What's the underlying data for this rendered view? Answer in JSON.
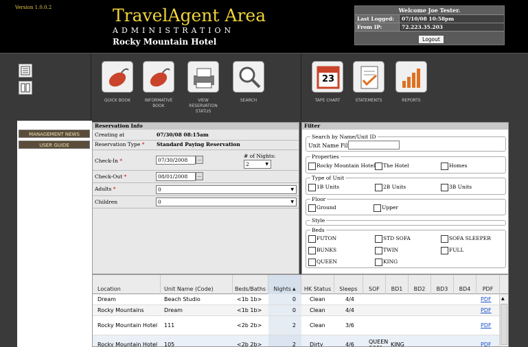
{
  "header": {
    "version": "Version 1.0.0.2",
    "brand": "TravelAgent Area",
    "admin": "ADMINISTRATION",
    "hotel": "Rocky Mountain Hotel",
    "welcome": "Welcome Joe Tester.",
    "last_logged_label": "Last Logged:",
    "last_logged_value": "07/10/08 10:58pm",
    "from_ip_label": "From IP:",
    "from_ip_value": "72.223.35.203",
    "logout": "Logout"
  },
  "toolbar": {
    "quick_book": "QUICK BOOK",
    "informative_book": "INFORMATIVE BOOK",
    "view_reservation": "VIEW RESERVATION STATUS",
    "search": "SEARCH",
    "tape_chart": "TAPE CHART",
    "tape_day": "23",
    "statements": "STATEMENTS",
    "reports": "REPORTS"
  },
  "nav": {
    "management_news": "MANAGEMENT NEWS",
    "user_guide": "USER GUIDE"
  },
  "reservation": {
    "title": "Reservation Info",
    "creating_at_label": "Creating at",
    "creating_at_value": "07/30/08 08:15am",
    "type_label": "Reservation Type",
    "type_value": "Standard Paying Reservation",
    "checkin_label": "Check-In",
    "checkin_value": "07/30/2008",
    "checkout_label": "Check-Out",
    "checkout_value": "08/01/2008",
    "nights_label": "# of Nights:",
    "nights_value": "2",
    "adults_label": "Adults",
    "adults_value": "0",
    "children_label": "Children",
    "children_value": "0",
    "req": "*"
  },
  "filter": {
    "title": "Filter",
    "search_group": "Search by Name/Unit ID",
    "unit_name_label": "Unit Name Filter:",
    "properties_group": "Properties",
    "properties": [
      "Rocky Mountain Hotel",
      "The Hotel",
      "Homes"
    ],
    "type_group": "Type of Unit",
    "types": [
      "1B Units",
      "2B Units",
      "3B Units"
    ],
    "floor_group": "Floor",
    "floors": [
      "Ground",
      "Upper"
    ],
    "style_group": "Style",
    "beds_group": "Beds",
    "beds": [
      "FUTON",
      "STD SOFA",
      "SOFA SLEEPER",
      "BUNKS",
      "TWIN",
      "FULL",
      "QUEEN",
      "KING"
    ]
  },
  "grid": {
    "headers": [
      "Location",
      "Unit Name (Code)",
      "Beds/Baths",
      "Nights",
      "HK Status",
      "Sleeps",
      "SOF",
      "BD1",
      "BD2",
      "BD3",
      "BD4",
      "PDF"
    ],
    "rows": [
      {
        "location": "Dream",
        "unit": "Beach Studio",
        "beds": "<1b 1b>",
        "nights": "0",
        "hk": "Clean",
        "sleeps": "4/4",
        "sof": "",
        "bd1": "",
        "pdf": "PDF"
      },
      {
        "location": "Rocky Mountains",
        "unit": "Dream",
        "beds": "<1b 1b>",
        "nights": "0",
        "hk": "Clean",
        "sleeps": "4/4",
        "sof": "",
        "bd1": "",
        "pdf": "PDF"
      },
      {
        "location": "Rocky Mountain Hotel",
        "unit": "111",
        "beds": "<2b 2b>",
        "nights": "2",
        "hk": "Clean",
        "sleeps": "3/6",
        "sof": "",
        "bd1": "",
        "pdf": "PDF"
      },
      {
        "location": "Rocky Mountain Hotel",
        "unit": "105",
        "beds": "<2b 2b>",
        "nights": "2",
        "hk": "Dirty",
        "sleeps": "4/6",
        "sof": "QUEEN SOFA",
        "bd1": "KING",
        "pdf": "PDF"
      }
    ]
  }
}
